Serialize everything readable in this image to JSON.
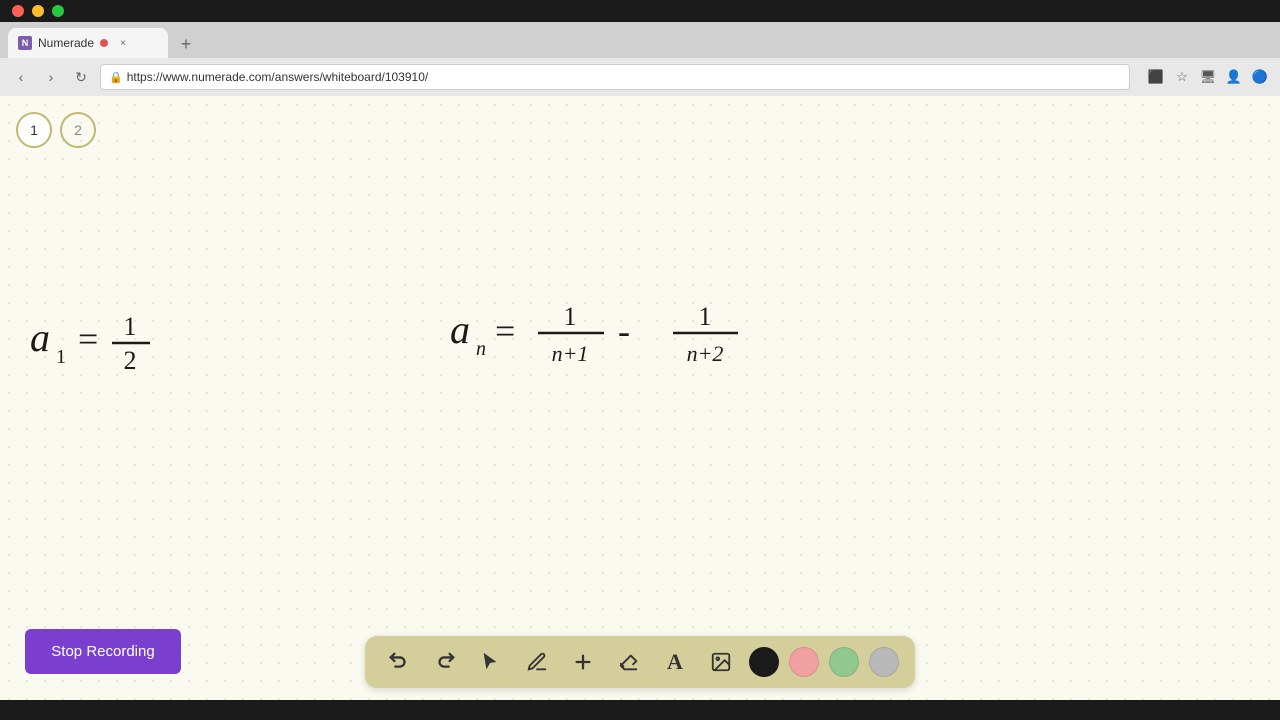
{
  "browser": {
    "tab": {
      "favicon_label": "N",
      "title": "Numerade",
      "close_label": "×",
      "new_tab_label": "+"
    },
    "url": "https://www.numerade.com/answers/whiteboard/103910/",
    "nav": {
      "back": "‹",
      "forward": "›",
      "refresh": "↻"
    }
  },
  "page_tabs": [
    {
      "label": "1",
      "state": "active"
    },
    {
      "label": "2",
      "state": "inactive"
    }
  ],
  "toolbar": {
    "tools": [
      {
        "name": "undo",
        "icon": "↩",
        "label": "Undo"
      },
      {
        "name": "redo",
        "icon": "↪",
        "label": "Redo"
      },
      {
        "name": "select",
        "icon": "↖",
        "label": "Select"
      },
      {
        "name": "pen",
        "icon": "✏",
        "label": "Pen"
      },
      {
        "name": "add",
        "icon": "+",
        "label": "Add"
      },
      {
        "name": "eraser",
        "icon": "◻",
        "label": "Eraser"
      },
      {
        "name": "text",
        "icon": "A",
        "label": "Text"
      },
      {
        "name": "image",
        "icon": "⬜",
        "label": "Image"
      }
    ],
    "colors": [
      {
        "name": "black",
        "hex": "#1a1a1a"
      },
      {
        "name": "pink",
        "hex": "#f0a0a0"
      },
      {
        "name": "green",
        "hex": "#90c890"
      },
      {
        "name": "gray",
        "hex": "#b8b8b8"
      }
    ]
  },
  "stop_recording_button": {
    "label": "Stop Recording"
  }
}
